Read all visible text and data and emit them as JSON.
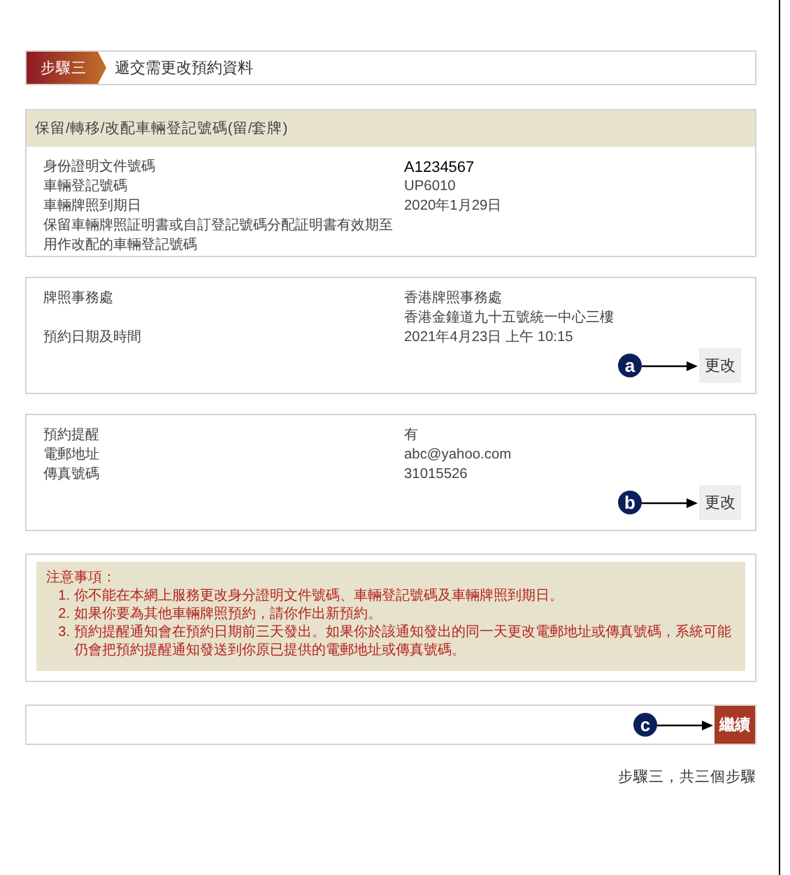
{
  "step_header": {
    "badge": "步驟三",
    "title": "遞交需更改預約資料"
  },
  "sections": [
    {
      "title": "保留/轉移/改配車輛登記號碼(留/套牌)",
      "rows": [
        {
          "label": "身份證明文件號碼",
          "value": "A1234567",
          "emphasis": true
        },
        {
          "label": "車輛登記號碼",
          "value": "UP6010",
          "emphasis": false
        },
        {
          "label": "車輛牌照到期日",
          "value": "2020年1月29日",
          "emphasis": false
        },
        {
          "label": "保留車輛牌照証明書或自訂登記號碼分配証明書有效期至"
        },
        {
          "label": "用作改配的車輛登記號碼"
        }
      ]
    },
    {
      "rows": [
        {
          "label": "牌照事務處",
          "value": "香港牌照事務處",
          "emphasis": false
        },
        {
          "label": "",
          "value": "香港金鐘道九十五號統一中心三樓",
          "emphasis": false
        },
        {
          "label": "預約日期及時間",
          "value": "2021年4月23日 上午 10:15",
          "emphasis": false
        }
      ],
      "button": {
        "label": "更改",
        "callout": "a"
      }
    },
    {
      "rows": [
        {
          "label": "預約提醒",
          "value": "有",
          "emphasis": false
        },
        {
          "label": "電郵地址",
          "value": "abc@yahoo.com",
          "emphasis": false
        },
        {
          "label": "傳真號碼",
          "value": "31015526",
          "emphasis": false
        }
      ],
      "button": {
        "label": "更改",
        "callout": "b"
      }
    }
  ],
  "notes": {
    "title": "注意事項：",
    "items": [
      {
        "number": "1.",
        "text": "你不能在本網上服務更改身分證明文件號碼、車輛登記號碼及車輛牌照到期日。"
      },
      {
        "number": "2.",
        "text": "如果你要為其他車輛牌照預約，請你作出新預約。"
      },
      {
        "number": "3.",
        "text": "預約提醒通知會在預約日期前三天發出。如果你於該通知發出的同一天更改電郵地址或傳真號碼，系統可能仍會把預約提醒通知發送到你原已提供的電郵地址或傳真號碼。"
      }
    ]
  },
  "continue_button": {
    "label": "繼續",
    "callout": "c"
  },
  "footer": "步驟三，共三個步驟"
}
